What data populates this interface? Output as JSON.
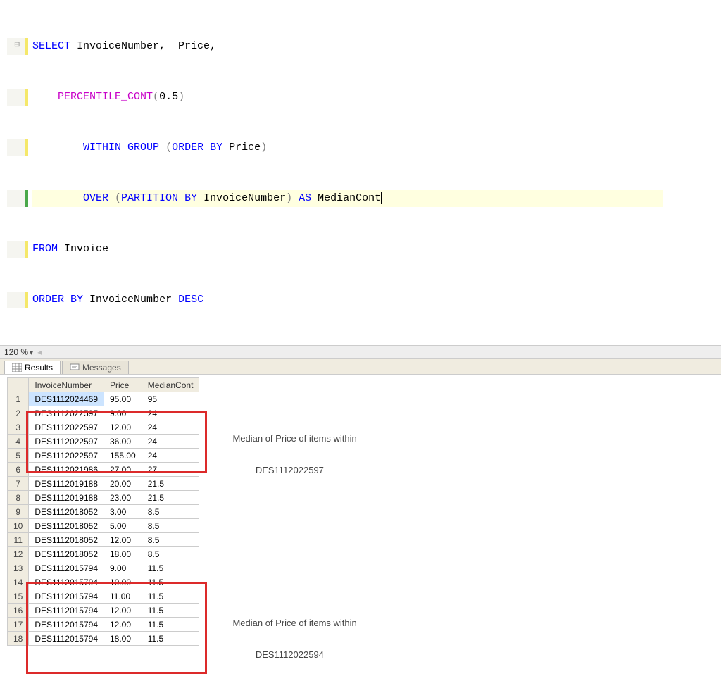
{
  "editor": {
    "zoom": "120 %",
    "code": {
      "l1_select": "SELECT",
      "l1_rest": " InvoiceNumber,  Price,",
      "l2_func": "PERCENTILE_CONT",
      "l2_open": "(",
      "l2_arg": "0.5",
      "l2_close": ")",
      "l3_within": "WITHIN",
      "l3_group": "GROUP",
      "l3_paren_o": " (",
      "l3_order": "ORDER",
      "l3_by": "BY",
      "l3_col": " Price",
      "l3_paren_c": ")",
      "l4_over": "OVER",
      "l4_paren_o": " (",
      "l4_partition": "PARTITION",
      "l4_by": "BY",
      "l4_col": " InvoiceNumber",
      "l4_paren_c": ")",
      "l4_as": " AS",
      "l4_alias": " MedianCont",
      "l5_from": "FROM",
      "l5_table": " Invoice",
      "l6_order": "ORDER",
      "l6_by": "BY",
      "l6_col": " InvoiceNumber ",
      "l6_desc": "DESC"
    }
  },
  "tabs": {
    "results": "Results",
    "messages": "Messages"
  },
  "columns": {
    "c1": "InvoiceNumber",
    "c2": "Price",
    "c3": "MedianCont"
  },
  "rows": [
    {
      "n": "1",
      "inv": "DES1112024469",
      "price": "95.00",
      "med": "95",
      "sel": true
    },
    {
      "n": "2",
      "inv": "DES1112022597",
      "price": "9.00",
      "med": "24"
    },
    {
      "n": "3",
      "inv": "DES1112022597",
      "price": "12.00",
      "med": "24"
    },
    {
      "n": "4",
      "inv": "DES1112022597",
      "price": "36.00",
      "med": "24"
    },
    {
      "n": "5",
      "inv": "DES1112022597",
      "price": "155.00",
      "med": "24"
    },
    {
      "n": "6",
      "inv": "DES1112021986",
      "price": "27.00",
      "med": "27"
    },
    {
      "n": "7",
      "inv": "DES1112019188",
      "price": "20.00",
      "med": "21.5"
    },
    {
      "n": "8",
      "inv": "DES1112019188",
      "price": "23.00",
      "med": "21.5"
    },
    {
      "n": "9",
      "inv": "DES1112018052",
      "price": "3.00",
      "med": "8.5"
    },
    {
      "n": "10",
      "inv": "DES1112018052",
      "price": "5.00",
      "med": "8.5"
    },
    {
      "n": "11",
      "inv": "DES1112018052",
      "price": "12.00",
      "med": "8.5"
    },
    {
      "n": "12",
      "inv": "DES1112018052",
      "price": "18.00",
      "med": "8.5"
    },
    {
      "n": "13",
      "inv": "DES1112015794",
      "price": "9.00",
      "med": "11.5"
    },
    {
      "n": "14",
      "inv": "DES1112015794",
      "price": "10.00",
      "med": "11.5"
    },
    {
      "n": "15",
      "inv": "DES1112015794",
      "price": "11.00",
      "med": "11.5"
    },
    {
      "n": "16",
      "inv": "DES1112015794",
      "price": "12.00",
      "med": "11.5"
    },
    {
      "n": "17",
      "inv": "DES1112015794",
      "price": "12.00",
      "med": "11.5"
    },
    {
      "n": "18",
      "inv": "DES1112015794",
      "price": "18.00",
      "med": "11.5"
    }
  ],
  "annotations": {
    "a1_line1": "Median of Price of items within",
    "a1_line2": "DES1112022597",
    "a2_line1": "Median of Price of items within",
    "a2_line2": "DES1112022594"
  }
}
